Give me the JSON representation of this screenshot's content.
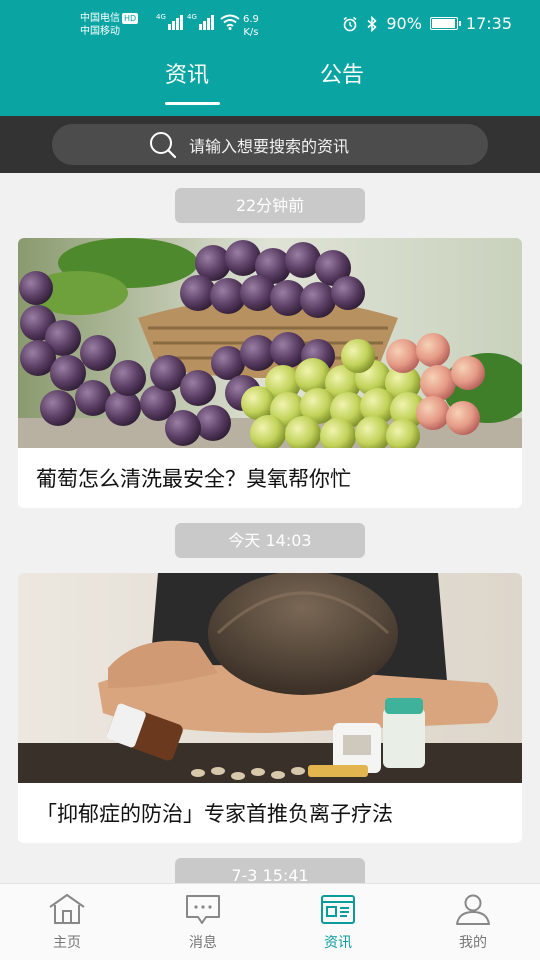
{
  "status_bar": {
    "carrier_1": "中国电信",
    "hd": "HD",
    "carrier_2": "中国移动",
    "net_type_1": "4G",
    "net_type_2": "4G",
    "speed_value": "6.9",
    "speed_unit": "K/s",
    "battery": "90%",
    "time": "17:35",
    "icons": [
      "alarm-icon",
      "bluetooth-icon",
      "battery-icon",
      "wifi-icon",
      "signal-icon"
    ]
  },
  "header": {
    "tabs": [
      {
        "label": "资讯",
        "active": true
      },
      {
        "label": "公告",
        "active": false
      }
    ]
  },
  "search": {
    "placeholder": "请输入想要搜索的资讯"
  },
  "feed": [
    {
      "time": "22分钟前",
      "title": "葡萄怎么清洗最安全？臭氧帮你忙",
      "image": "grapes"
    },
    {
      "time": "今天 14:03",
      "title": "「抑郁症的防治」专家首推负离子疗法",
      "image": "person-with-pills"
    },
    {
      "time": "7-3 15:41"
    }
  ],
  "bottom_nav": [
    {
      "label": "主页",
      "icon": "home-icon",
      "active": false
    },
    {
      "label": "消息",
      "icon": "message-icon",
      "active": false
    },
    {
      "label": "资讯",
      "icon": "news-icon",
      "active": true
    },
    {
      "label": "我的",
      "icon": "profile-icon",
      "active": false
    }
  ],
  "colors": {
    "header": "#0aa5a3",
    "search_strip": "#333333",
    "active_nav": "#0a9c9a",
    "time_pill": "#c9c9c9"
  }
}
